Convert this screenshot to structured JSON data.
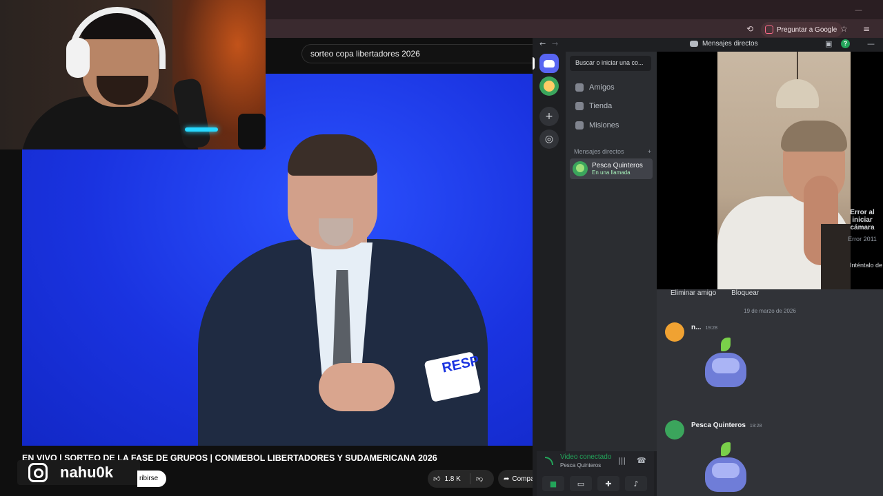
{
  "browser": {
    "ask_google_label": "Preguntar a Google"
  },
  "youtube": {
    "search_value": "sorteo copa libertadores 2026",
    "video_title": "EN VIVO | SORTEO DE LA FASE DE GRUPOS | CONMEBOL LIBERTADORES Y SUDAMERICANA 2026",
    "subscribe_label": "ribirse",
    "like_count": "1.8 K",
    "share_label": "Compartir",
    "armband_text": "RESP"
  },
  "overlay": {
    "instagram_handle": "nahu0k"
  },
  "discord": {
    "window_title": "Mensajes directos",
    "search_placeholder": "Buscar o iniciar una co...",
    "nav": [
      {
        "label": "Amigos"
      },
      {
        "label": "Tienda"
      },
      {
        "label": "Misiones"
      }
    ],
    "dm_header": "Mensajes directos",
    "dm_user": {
      "name": "Pesca Quinteros",
      "status": "En una llamada"
    },
    "camera_error": {
      "title": "Error al iniciar cámara",
      "code": "Error 2011",
      "retry": "Inténtalo de nu"
    },
    "chat_actions": [
      "Eliminar amigo",
      "Bloquear"
    ],
    "date_divider": "19 de marzo de 2026",
    "messages": [
      {
        "author": "n...",
        "time": "19:28"
      },
      {
        "author": "Pesca Quinteros",
        "time": "19:28"
      }
    ],
    "voice": {
      "status": "Video conectado",
      "channel": "Pesca Quinteros"
    },
    "colors": {
      "blurple": "#5865f2",
      "green": "#23a55a",
      "bg": "#1e1f22"
    }
  }
}
